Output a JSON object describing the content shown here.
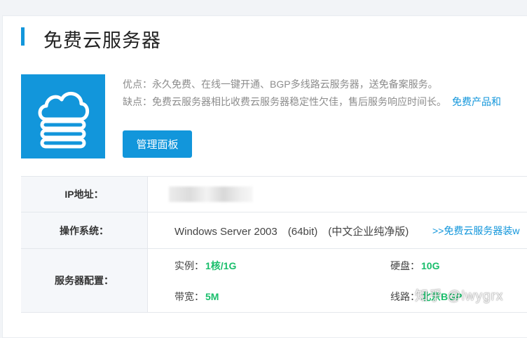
{
  "header": {
    "title": "免费云服务器"
  },
  "product": {
    "icon": "cloud-server-icon",
    "pros": "优点：永久免费、在线一键开通、BGP多线路云服务器，送免备案服务。",
    "cons": "缺点：免费云服务器相比收费云服务器稳定性欠佳，售后服务响应时间长。",
    "cons_link": "免费产品和",
    "panel_button": "管理面板"
  },
  "details": {
    "ip_label": "IP地址：",
    "os_label": "操作系统：",
    "os_value": "Windows Server 2003　(64bit)　(中文企业纯净版)",
    "os_link": ">>免费云服务器装w",
    "config_label": "服务器配置：",
    "instance_label": "实例：",
    "instance_value": "1核/1G",
    "disk_label": "硬盘：",
    "disk_value": "10G",
    "bandwidth_label": "带宽：",
    "bandwidth_value": "5M",
    "line_label": "线路：",
    "line_value": "北京BGP"
  },
  "watermark": "知乎 @lwygrx",
  "colors": {
    "accent": "#1296db",
    "value_green": "#19be6b"
  }
}
